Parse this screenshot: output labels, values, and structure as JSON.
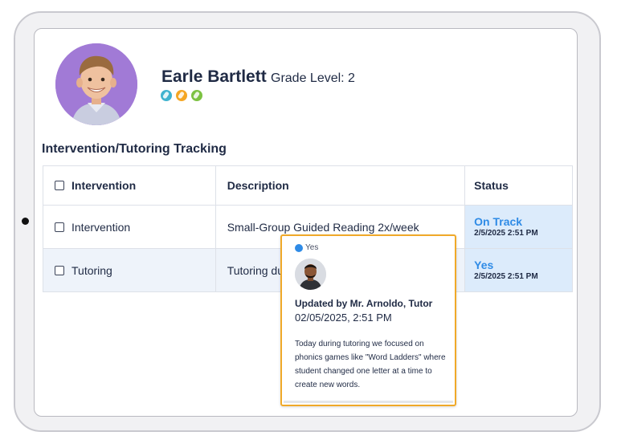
{
  "student": {
    "name": "Earle Bartlett",
    "grade_level": "Grade Level: 2",
    "badges": [
      {
        "icon": "leaf-badge-icon",
        "color": "#3fb3cf"
      },
      {
        "icon": "leaf-badge-icon",
        "color": "#f5a623"
      },
      {
        "icon": "leaf-badge-icon",
        "color": "#7cc242"
      }
    ]
  },
  "section_title": "Intervention/Tutoring Tracking",
  "table": {
    "headers": [
      "Intervention",
      "Description",
      "Status"
    ],
    "rows": [
      {
        "intervention": "Intervention",
        "description": "Small-Group Guided Reading 2x/week",
        "status": "On Track",
        "status_time": "2/5/2025 2:51 PM"
      },
      {
        "intervention": "Tutoring",
        "description": "Tutoring du",
        "status": "Yes",
        "status_time": "2/5/2025 2:51 PM"
      }
    ]
  },
  "popover": {
    "status": "Yes",
    "updated_by": "Updated by Mr. Arnoldo, Tutor",
    "date": "02/05/2025, 2:51 PM",
    "note": "Today during tutoring we focused on phonics games like \"Word Ladders\" where student changed one letter at a time to create new words."
  },
  "colors": {
    "accent_blue": "#2f8be6",
    "popover_border": "#f0a929",
    "status_bg": "#dcebfb",
    "text_dark": "#1f2a44"
  }
}
